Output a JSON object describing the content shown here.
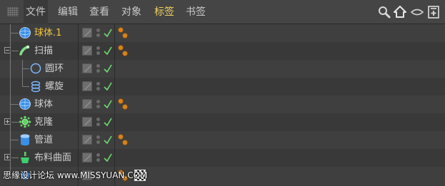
{
  "menu": {
    "items": [
      {
        "label": "文件",
        "active": false
      },
      {
        "label": "编辑",
        "active": false
      },
      {
        "label": "查看",
        "active": false
      },
      {
        "label": "对象",
        "active": false
      },
      {
        "label": "标签",
        "active": true
      },
      {
        "label": "书签",
        "active": false
      }
    ],
    "toolbar_icons": [
      "search-icon",
      "home-icon",
      "eye-icon",
      "new-window-icon"
    ]
  },
  "objects": [
    {
      "name": "球体.1",
      "icon": "sphere-icon",
      "selected": true,
      "expander": "none",
      "has_orange_tag": true,
      "has_checker_tag": false
    },
    {
      "name": "扫描",
      "icon": "sweep-icon",
      "selected": false,
      "expander": "expanded",
      "has_orange_tag": true,
      "has_checker_tag": false
    },
    {
      "name": "圆环",
      "icon": "circle-spline-icon",
      "selected": false,
      "expander": "none",
      "has_orange_tag": false,
      "has_checker_tag": false
    },
    {
      "name": "螺旋",
      "icon": "helix-icon",
      "selected": false,
      "expander": "none",
      "has_orange_tag": false,
      "has_checker_tag": false
    },
    {
      "name": "球体",
      "icon": "sphere-icon",
      "selected": false,
      "expander": "none",
      "has_orange_tag": true,
      "has_checker_tag": false
    },
    {
      "name": "克隆",
      "icon": "cloner-icon",
      "selected": false,
      "expander": "collapsed",
      "has_orange_tag": false,
      "has_checker_tag": false
    },
    {
      "name": "管道",
      "icon": "tube-icon",
      "selected": false,
      "expander": "none",
      "has_orange_tag": true,
      "has_checker_tag": false
    },
    {
      "name": "布料曲面",
      "icon": "cloth-surface-icon",
      "selected": false,
      "expander": "collapsed",
      "has_orange_tag": false,
      "has_checker_tag": false
    },
    {
      "name": "",
      "icon": "object-icon",
      "selected": false,
      "expander": "none",
      "has_orange_tag": true,
      "has_checker_tag": true
    }
  ],
  "colors": {
    "selected_text": "#f3c441",
    "active_menu": "#f0d060",
    "check_green": "#6fdc6f",
    "tag_orange": "#d4821e"
  },
  "watermark": "思缘设计论坛  www.MISSYUAN.COM"
}
